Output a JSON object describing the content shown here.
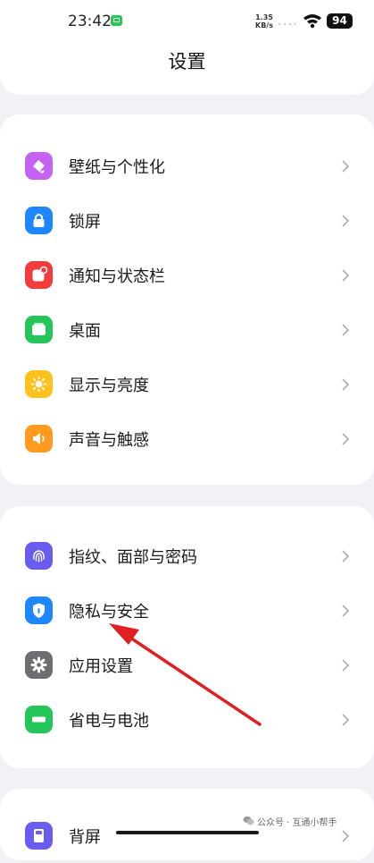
{
  "status_bar": {
    "time": "23:42",
    "net_speed_value": "1.35",
    "net_speed_unit": "KB/s",
    "signal_dots": "••••",
    "battery": "94",
    "icons": [
      "message-icon",
      "wifi-icon",
      "battery-icon"
    ]
  },
  "header": {
    "title": "设置"
  },
  "group1": {
    "items": [
      {
        "label": "壁纸与个性化",
        "icon": "palette-icon",
        "color": "#c463f2"
      },
      {
        "label": "锁屏",
        "icon": "lock-icon",
        "color": "#1e86ff"
      },
      {
        "label": "通知与状态栏",
        "icon": "notification-icon",
        "color": "#f23b3b"
      },
      {
        "label": "桌面",
        "icon": "home-screen-icon",
        "color": "#24c559"
      },
      {
        "label": "显示与亮度",
        "icon": "brightness-icon",
        "color": "#ffc21c"
      },
      {
        "label": "声音与触感",
        "icon": "speaker-icon",
        "color": "#ff9a1f"
      }
    ]
  },
  "group2": {
    "items": [
      {
        "label": "指纹、面部与密码",
        "icon": "fingerprint-icon",
        "color": "#6b5cf0"
      },
      {
        "label": "隐私与安全",
        "icon": "shield-icon",
        "color": "#1e86ff"
      },
      {
        "label": "应用设置",
        "icon": "gear-icon",
        "color": "#6d6d72"
      },
      {
        "label": "省电与电池",
        "icon": "battery-saver-icon",
        "color": "#24c559"
      }
    ]
  },
  "group3": {
    "items": [
      {
        "label": "背屏",
        "icon": "back-screen-icon",
        "color": "#6b5cf0"
      }
    ]
  },
  "annotation": {
    "arrow_color": "#e02020"
  },
  "watermark": {
    "text": "公众号 · 互通小帮手"
  }
}
